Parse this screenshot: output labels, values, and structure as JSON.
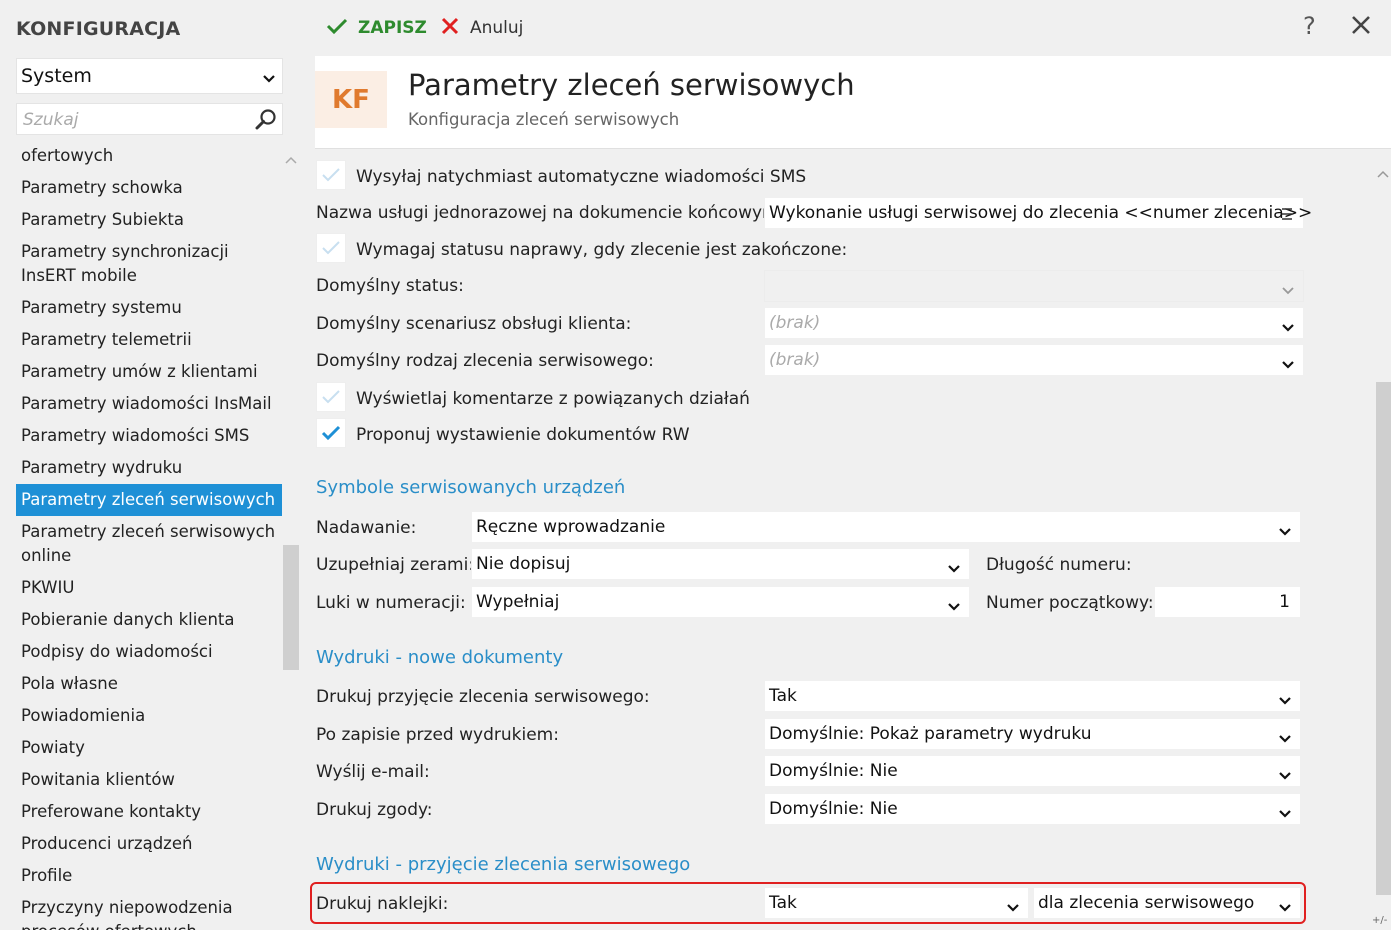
{
  "app": {
    "title": "KONFIGURACJA"
  },
  "sidebar": {
    "module": "System",
    "search_placeholder": "Szukaj",
    "items": [
      {
        "label": "ofertowych"
      },
      {
        "label": "Parametry schowka"
      },
      {
        "label": "Parametry Subiekta"
      },
      {
        "label": "Parametry synchronizacji InsERT mobile"
      },
      {
        "label": "Parametry systemu"
      },
      {
        "label": "Parametry telemetrii"
      },
      {
        "label": "Parametry umów z klientami"
      },
      {
        "label": "Parametry wiadomości InsMail"
      },
      {
        "label": "Parametry wiadomości SMS"
      },
      {
        "label": "Parametry wydruku"
      },
      {
        "label": "Parametry zleceń serwisowych",
        "active": true
      },
      {
        "label": "Parametry zleceń serwisowych online"
      },
      {
        "label": "PKWIU"
      },
      {
        "label": "Pobieranie danych klienta"
      },
      {
        "label": "Podpisy do wiadomości"
      },
      {
        "label": "Pola własne"
      },
      {
        "label": "Powiadomienia"
      },
      {
        "label": "Powiaty"
      },
      {
        "label": "Powitania klientów"
      },
      {
        "label": "Preferowane kontakty"
      },
      {
        "label": "Producenci urządzeń"
      },
      {
        "label": "Profile"
      },
      {
        "label": "Przyczyny niepowodzenia procesów ofertowych"
      }
    ]
  },
  "toolbar": {
    "save_label": "ZAPISZ",
    "cancel_label": "Anuluj",
    "help_label": "?"
  },
  "header": {
    "badge": "KF",
    "title": "Parametry zleceń serwisowych",
    "subtitle": "Konfiguracja zleceń serwisowych"
  },
  "form": {
    "sms_checkbox": {
      "label": "Wysyłaj natychmiast automatyczne wiadomości SMS",
      "checked": false
    },
    "service_name": {
      "label": "Nazwa usługi jednorazowej na dokumencie końcowym:",
      "value": "Wykonanie usługi serwisowej do zlecenia <<numer zlecenia>>"
    },
    "require_status": {
      "label": "Wymagaj statusu naprawy, gdy zlecenie jest zakończone:",
      "checked": false
    },
    "default_status": {
      "label": "Domyślny status:",
      "value": ""
    },
    "default_scenario": {
      "label": "Domyślny scenariusz obsługi klienta:",
      "value": "(brak)"
    },
    "default_type": {
      "label": "Domyślny rodzaj zlecenia serwisowego:",
      "value": "(brak)"
    },
    "show_comments": {
      "label": "Wyświetlaj komentarze z powiązanych działań",
      "checked": false
    },
    "propose_rw": {
      "label": "Proponuj wystawienie dokumentów RW",
      "checked": true
    }
  },
  "symbols": {
    "section_title": "Symbole serwisowanych urządzeń",
    "assign": {
      "label": "Nadawanie:",
      "value": "Ręczne wprowadzanie"
    },
    "zeros": {
      "label": "Uzupełniaj zerami:",
      "value": "Nie dopisuj"
    },
    "length": {
      "label": "Długość numeru:",
      "value": ""
    },
    "gaps": {
      "label": "Luki w numeracji:",
      "value": "Wypełniaj"
    },
    "start_number": {
      "label": "Numer początkowy:",
      "value": "1"
    }
  },
  "prints_new": {
    "section_title": "Wydruki - nowe dokumenty",
    "print_acceptance": {
      "label": "Drukuj przyjęcie zlecenia serwisowego:",
      "value": "Tak"
    },
    "after_save": {
      "label": "Po zapisie przed wydrukiem:",
      "value": "Domyślnie: Pokaż parametry wydruku"
    },
    "send_email": {
      "label": "Wyślij e-mail:",
      "value": "Domyślnie: Nie"
    },
    "print_consents": {
      "label": "Drukuj zgody:",
      "value": "Domyślnie: Nie"
    }
  },
  "prints_acceptance": {
    "section_title": "Wydruki - przyjęcie zlecenia serwisowego",
    "print_stickers": {
      "label": "Drukuj naklejki:",
      "value": "Tak",
      "scope": "dla zlecenia serwisowego"
    }
  },
  "misc": {
    "plusminus": "+/-"
  },
  "colors": {
    "accent": "#1e90d6",
    "section": "#2a8ec8",
    "save": "#2e8b2e",
    "cancel": "#e02020",
    "badge_bg": "#fbeee4",
    "badge_fg": "#e07a2e",
    "highlight": "#e02020"
  }
}
